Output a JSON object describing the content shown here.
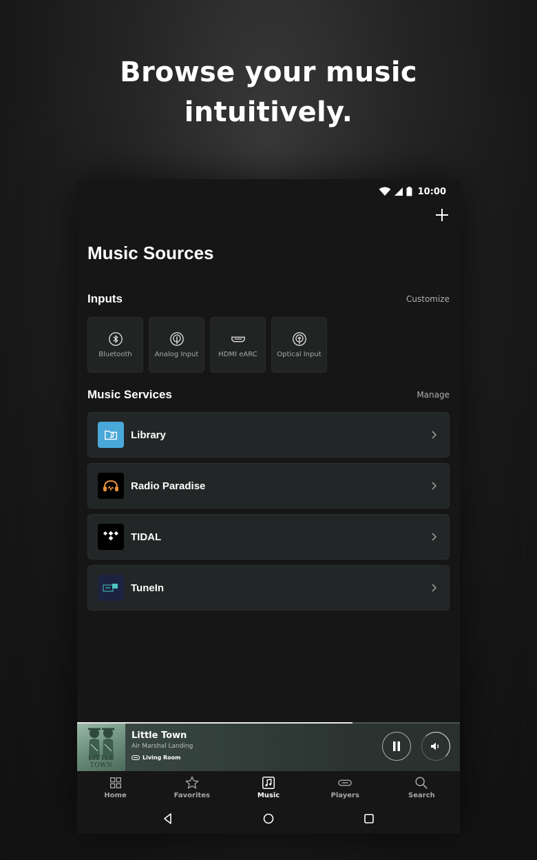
{
  "headline": {
    "line1": "Browse your music",
    "line2": "intuitively."
  },
  "status_bar": {
    "time": "10:00"
  },
  "page": {
    "title": "Music Sources"
  },
  "inputs": {
    "title": "Inputs",
    "action": "Customize",
    "items": [
      {
        "label": "Bluetooth",
        "icon": "bluetooth-icon"
      },
      {
        "label": "Analog Input",
        "icon": "analog-input-icon"
      },
      {
        "label": "HDMI eARC",
        "icon": "hdmi-icon"
      },
      {
        "label": "Optical Input",
        "icon": "optical-input-icon"
      }
    ]
  },
  "services": {
    "title": "Music Services",
    "action": "Manage",
    "items": [
      {
        "label": "Library",
        "icon": "library-folder-icon",
        "color": "#4aa8d8"
      },
      {
        "label": "Radio Paradise",
        "icon": "radio-paradise-icon",
        "color": "#000000"
      },
      {
        "label": "TIDAL",
        "icon": "tidal-icon",
        "color": "#000000"
      },
      {
        "label": "TuneIn",
        "icon": "tunein-icon",
        "color": "#1c2340"
      }
    ]
  },
  "now_playing": {
    "title": "Little Town",
    "artist": "Air Marshal Landing",
    "room": "Living Room",
    "album_art_text": "LITTLE TOWN",
    "progress": 0.72,
    "state": "playing"
  },
  "tabs": [
    {
      "label": "Home",
      "icon": "home-grid-icon",
      "active": false
    },
    {
      "label": "Favorites",
      "icon": "star-icon",
      "active": false
    },
    {
      "label": "Music",
      "icon": "music-note-icon",
      "active": true
    },
    {
      "label": "Players",
      "icon": "speaker-icon",
      "active": false
    },
    {
      "label": "Search",
      "icon": "search-icon",
      "active": false
    }
  ]
}
